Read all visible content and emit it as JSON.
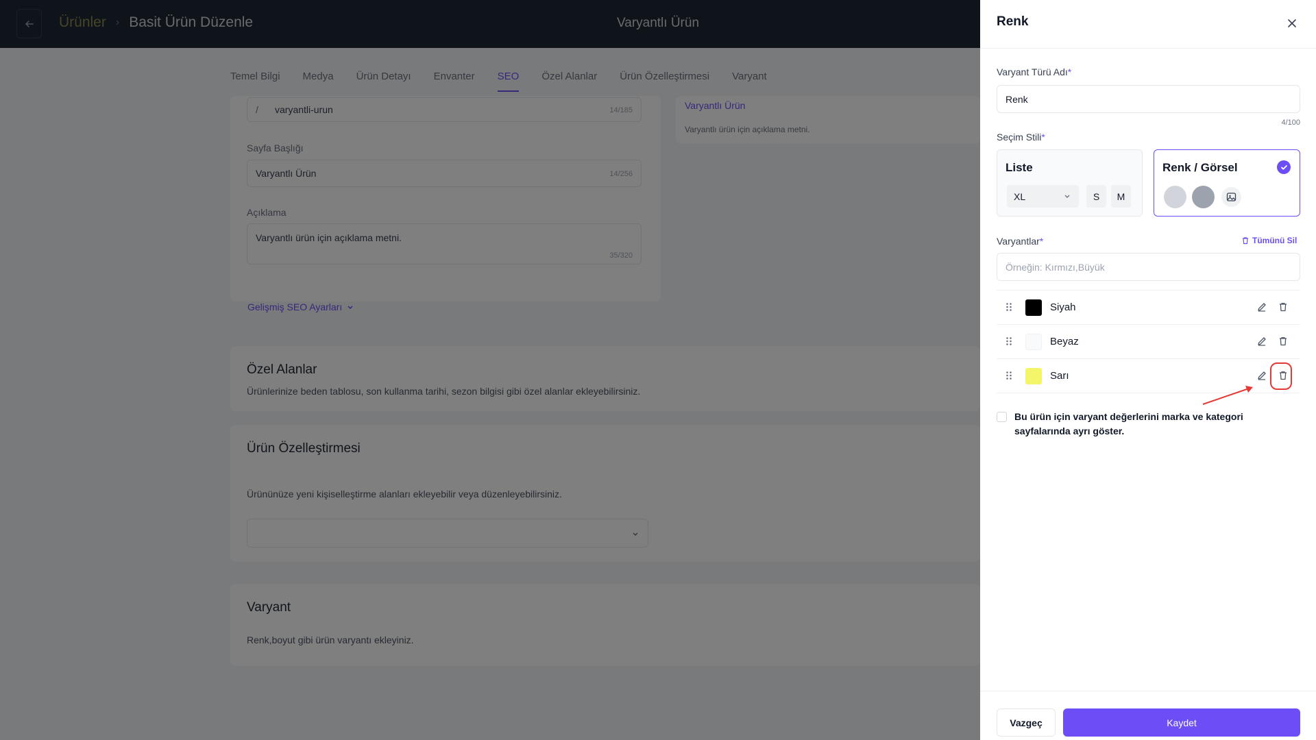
{
  "topbar": {
    "breadcrumb_root": "Ürünler",
    "breadcrumb_current": "Basit Ürün Düzenle",
    "title": "Varyantlı Ürün"
  },
  "tabs": [
    {
      "label": "Temel Bilgi",
      "active": false
    },
    {
      "label": "Medya",
      "active": false
    },
    {
      "label": "Ürün Detayı",
      "active": false
    },
    {
      "label": "Envanter",
      "active": false
    },
    {
      "label": "SEO",
      "active": true
    },
    {
      "label": "Özel Alanlar",
      "active": false
    },
    {
      "label": "Ürün Özelleştirmesi",
      "active": false
    },
    {
      "label": "Varyant",
      "active": false
    }
  ],
  "seo": {
    "url_prefix": "/",
    "url_value": "varyantli-urun",
    "url_counter": "14/185",
    "page_title_label": "Sayfa Başlığı",
    "page_title_value": "Varyantlı Ürün",
    "page_title_counter": "14/256",
    "description_label": "Açıklama",
    "description_value": "Varyantlı ürün için açıklama metni.",
    "description_counter": "35/320",
    "advanced_link": "Gelişmiş SEO Ayarları",
    "preview_title": "Varyantlı Ürün",
    "preview_desc": "Varyantlı ürün için açıklama metni."
  },
  "custom_fields": {
    "title": "Özel Alanlar",
    "desc": "Ürünlerinize beden tablosu, son kullanma tarihi, sezon bilgisi gibi özel alanlar ekleyebilirsiniz."
  },
  "customization": {
    "title": "Ürün Özelleştirmesi",
    "desc": "Ürününüze yeni kişiselleştirme alanları ekleyebilir veya düzenleyebilirsiniz."
  },
  "variant_section": {
    "title": "Varyant",
    "desc": "Renk,boyut gibi ürün varyantı ekleyiniz."
  },
  "drawer": {
    "title": "Renk",
    "type_name_label": "Varyant Türü Adı",
    "required_mark": "*",
    "type_name_value": "Renk",
    "type_name_counter": "4/100",
    "style_label": "Seçim Stili",
    "style_list": {
      "title": "Liste",
      "select_value": "XL",
      "chips": [
        "S",
        "M"
      ]
    },
    "style_color": {
      "title": "Renk / Görsel",
      "selected": true,
      "swatches": [
        "#d1d5db",
        "#9ca3af"
      ]
    },
    "variants_label": "Varyantlar",
    "clear_all": "Tümünü Sil",
    "variants_placeholder": "Örneğin: Kırmızı,Büyük",
    "variants": [
      {
        "name": "Siyah",
        "color": "#000000"
      },
      {
        "name": "Beyaz",
        "color": "#f9fafb"
      },
      {
        "name": "Sarı",
        "color": "#f5f56a"
      }
    ],
    "checkbox_text": "Bu ürün için varyant değerlerini marka ve kategori sayfalarında ayrı göster.",
    "cancel": "Vazgeç",
    "save": "Kaydet"
  },
  "colors": {
    "accent": "#6d4ef6",
    "highlight": "#e53935"
  }
}
